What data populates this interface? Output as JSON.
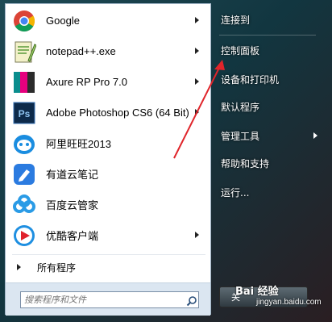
{
  "programs": [
    {
      "label": "Google",
      "icon": "chrome-icon",
      "has_submenu": true
    },
    {
      "label": "notepad++.exe",
      "icon": "notepadpp-icon",
      "has_submenu": true
    },
    {
      "label": "Axure RP Pro 7.0",
      "icon": "axure-icon",
      "has_submenu": true
    },
    {
      "label": "Adobe Photoshop CS6 (64 Bit)",
      "icon": "photoshop-icon",
      "has_submenu": true
    },
    {
      "label": "阿里旺旺2013",
      "icon": "aliwangwang-icon",
      "has_submenu": false
    },
    {
      "label": "有道云笔记",
      "icon": "youdao-note-icon",
      "has_submenu": false
    },
    {
      "label": "百度云管家",
      "icon": "baidu-cloud-icon",
      "has_submenu": false
    },
    {
      "label": "优酷客户端",
      "icon": "youku-icon",
      "has_submenu": true
    }
  ],
  "all_programs_label": "所有程序",
  "search": {
    "placeholder": "搜索程序和文件"
  },
  "right_items": [
    {
      "label": "连接到",
      "has_submenu": false
    },
    {
      "label": "控制面板",
      "has_submenu": false
    },
    {
      "label": "设备和打印机",
      "has_submenu": false
    },
    {
      "label": "默认程序",
      "has_submenu": false
    },
    {
      "label": "管理工具",
      "has_submenu": true
    },
    {
      "label": "帮助和支持",
      "has_submenu": false
    },
    {
      "label": "运行...",
      "has_submenu": false
    }
  ],
  "shutdown_label": "关",
  "watermark": {
    "logo": "Bai 经验",
    "url": "jingyan.baidu.com"
  },
  "colors": {
    "annotation_arrow": "#e0252b",
    "menu_left_bg": "#ffffff",
    "menu_right_text": "#ffffff"
  }
}
